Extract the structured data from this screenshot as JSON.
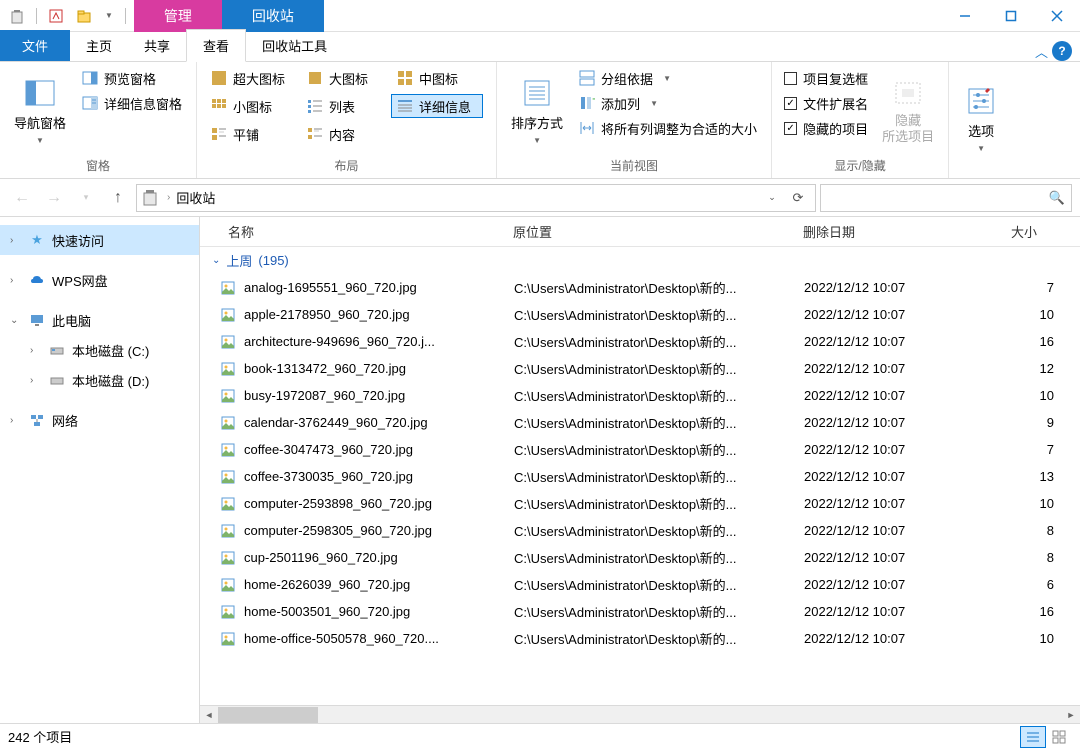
{
  "title_context_tab": "管理",
  "title_main_tab": "回收站",
  "tabs": {
    "file": "文件",
    "home": "主页",
    "share": "共享",
    "view": "查看",
    "tool": "回收站工具"
  },
  "ribbon": {
    "panes_label": "窗格",
    "layout_label": "布局",
    "current_view_label": "当前视图",
    "show_hide_label": "显示/隐藏",
    "nav_pane": "导航窗格",
    "preview_pane": "预览窗格",
    "details_pane": "详细信息窗格",
    "view_xl": "超大图标",
    "view_l": "大图标",
    "view_m": "中图标",
    "view_s": "小图标",
    "view_list": "列表",
    "view_details": "详细信息",
    "view_tiles": "平铺",
    "view_content": "内容",
    "sort_by": "排序方式",
    "group_by": "分组依据",
    "add_column": "添加列",
    "fit_columns": "将所有列调整为合适的大小",
    "item_checkboxes": "项目复选框",
    "file_ext": "文件扩展名",
    "hidden_items": "隐藏的项目",
    "hide_selected": "隐藏\n所选项目",
    "options": "选项"
  },
  "address": "回收站",
  "sidebar": {
    "quick": "快速访问",
    "wps": "WPS网盘",
    "thispc": "此电脑",
    "drive_c": "本地磁盘 (C:)",
    "drive_d": "本地磁盘 (D:)",
    "network": "网络"
  },
  "columns": {
    "name": "名称",
    "loc": "原位置",
    "date": "删除日期",
    "size": "大小"
  },
  "group": {
    "label": "上周",
    "count": "(195)"
  },
  "common_loc": "C:\\Users\\Administrator\\Desktop\\新的...",
  "common_date": "2022/12/12 10:07",
  "files": [
    {
      "name": "analog-1695551_960_720.jpg",
      "size": "7"
    },
    {
      "name": "apple-2178950_960_720.jpg",
      "size": "10"
    },
    {
      "name": "architecture-949696_960_720.j...",
      "size": "16"
    },
    {
      "name": "book-1313472_960_720.jpg",
      "size": "12"
    },
    {
      "name": "busy-1972087_960_720.jpg",
      "size": "10"
    },
    {
      "name": "calendar-3762449_960_720.jpg",
      "size": "9"
    },
    {
      "name": "coffee-3047473_960_720.jpg",
      "size": "7"
    },
    {
      "name": "coffee-3730035_960_720.jpg",
      "size": "13"
    },
    {
      "name": "computer-2593898_960_720.jpg",
      "size": "10"
    },
    {
      "name": "computer-2598305_960_720.jpg",
      "size": "8"
    },
    {
      "name": "cup-2501196_960_720.jpg",
      "size": "8"
    },
    {
      "name": "home-2626039_960_720.jpg",
      "size": "6"
    },
    {
      "name": "home-5003501_960_720.jpg",
      "size": "16"
    },
    {
      "name": "home-office-5050578_960_720....",
      "size": "10"
    }
  ],
  "status": "242 个项目"
}
